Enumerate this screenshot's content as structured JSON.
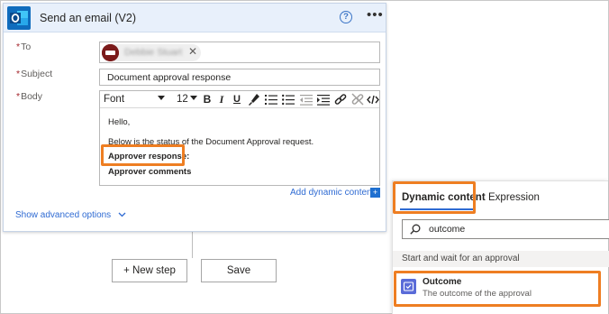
{
  "action_card": {
    "title": "Send an email (V2)",
    "help_glyph": "?",
    "more_glyph": "•••",
    "icon": "outlook-icon"
  },
  "fields": {
    "to": {
      "label": "To",
      "token_name": "Debbie Stuart",
      "remove_glyph": "✕"
    },
    "subject": {
      "label": "Subject",
      "value": "Document approval response"
    },
    "body": {
      "label": "Body",
      "toolbar": {
        "font": "Font",
        "size": "12",
        "bold": "B",
        "italic": "I",
        "underline": "U"
      },
      "lines": [
        "Hello,",
        "Below is the status of the Document Approval request.",
        "Approver response:",
        "Approver comments"
      ]
    }
  },
  "required_marker": "*",
  "add_dynamic_content": "Add dynamic content",
  "add_dynamic_glyph": "+",
  "show_advanced_options": "Show advanced options",
  "buttons": {
    "new_step": "+ New step",
    "save": "Save"
  },
  "dynamic_panel": {
    "tabs": [
      "Dynamic content",
      "Expression"
    ],
    "search_value": "outcome",
    "group_header": "Start and wait for an approval",
    "item": {
      "title": "Outcome",
      "description": "The outcome of the approval"
    }
  },
  "colors": {
    "highlight": "#ee7e22",
    "link": "#2f6bd3",
    "outlook_blue": "#0f6cbd"
  }
}
